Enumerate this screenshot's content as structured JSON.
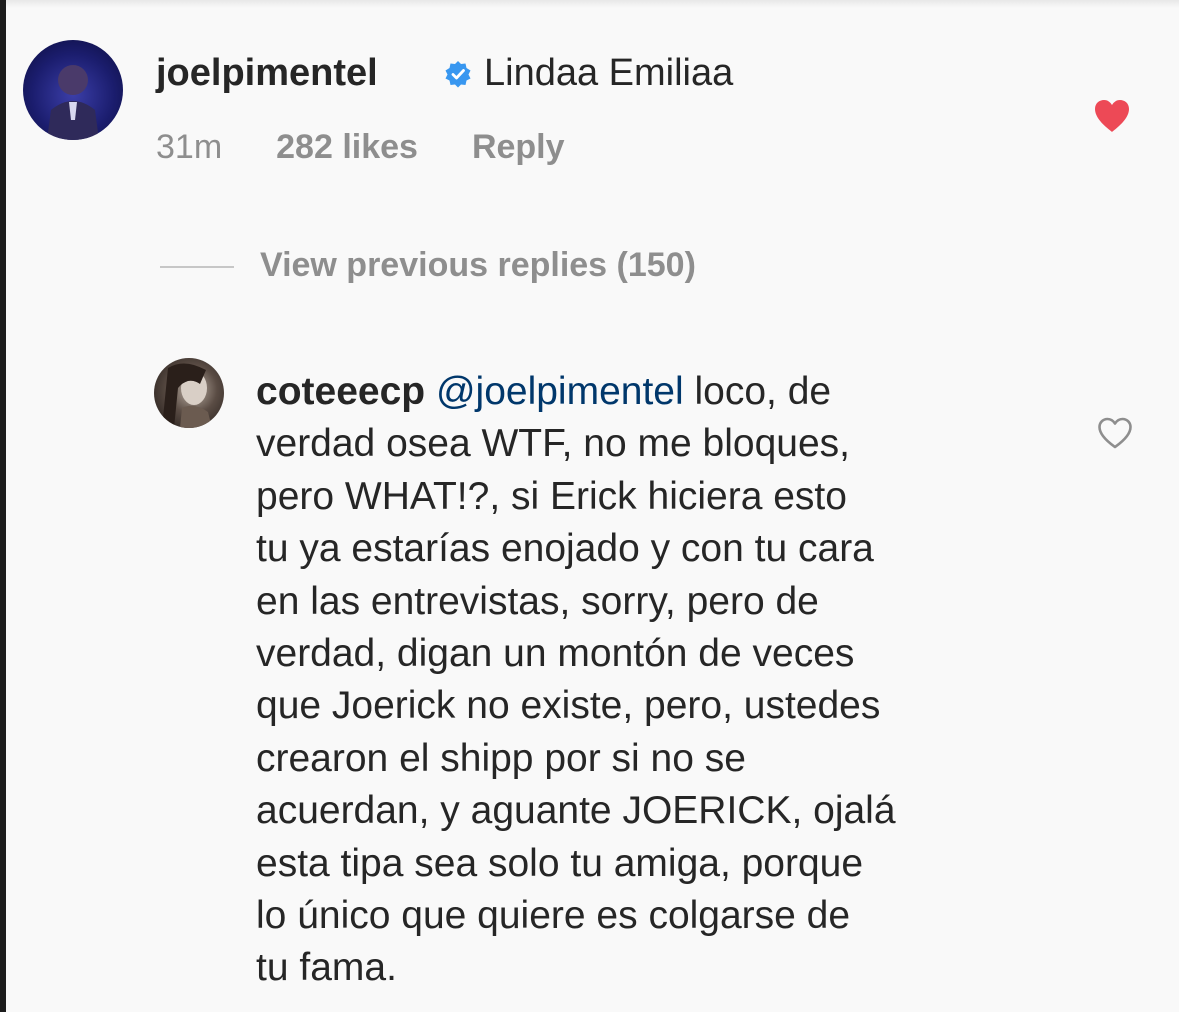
{
  "comment": {
    "username": "joelpimentel",
    "text": "Lindaa Emiliaa",
    "time": "31m",
    "likes": "282 likes",
    "reply_label": "Reply",
    "liked": true,
    "verified": true,
    "colors": {
      "heart": "#ed4956",
      "verified": "#3897f0"
    }
  },
  "replies": {
    "view_previous_label": "View previous replies (150)"
  },
  "reply": {
    "username": "coteeecp",
    "mention": "@joelpimentel",
    "first_line_rest": " loco, de",
    "lines": [
      "verdad osea WTF, no me bloques,",
      "pero WHAT!?, si Erick hiciera esto",
      "tu ya estarías enojado y con tu cara",
      "en las entrevistas, sorry, pero de",
      "verdad, digan un montón de veces",
      "que Joerick no existe, pero, ustedes",
      "crearon el shipp por si no se",
      "acuerdan, y aguante JOERICK, ojalá",
      "esta tipa sea solo tu amiga, porque",
      "lo único que quiere es colgarse de",
      "tu fama."
    ],
    "liked": false,
    "colors": {
      "mention": "#00376b"
    }
  }
}
